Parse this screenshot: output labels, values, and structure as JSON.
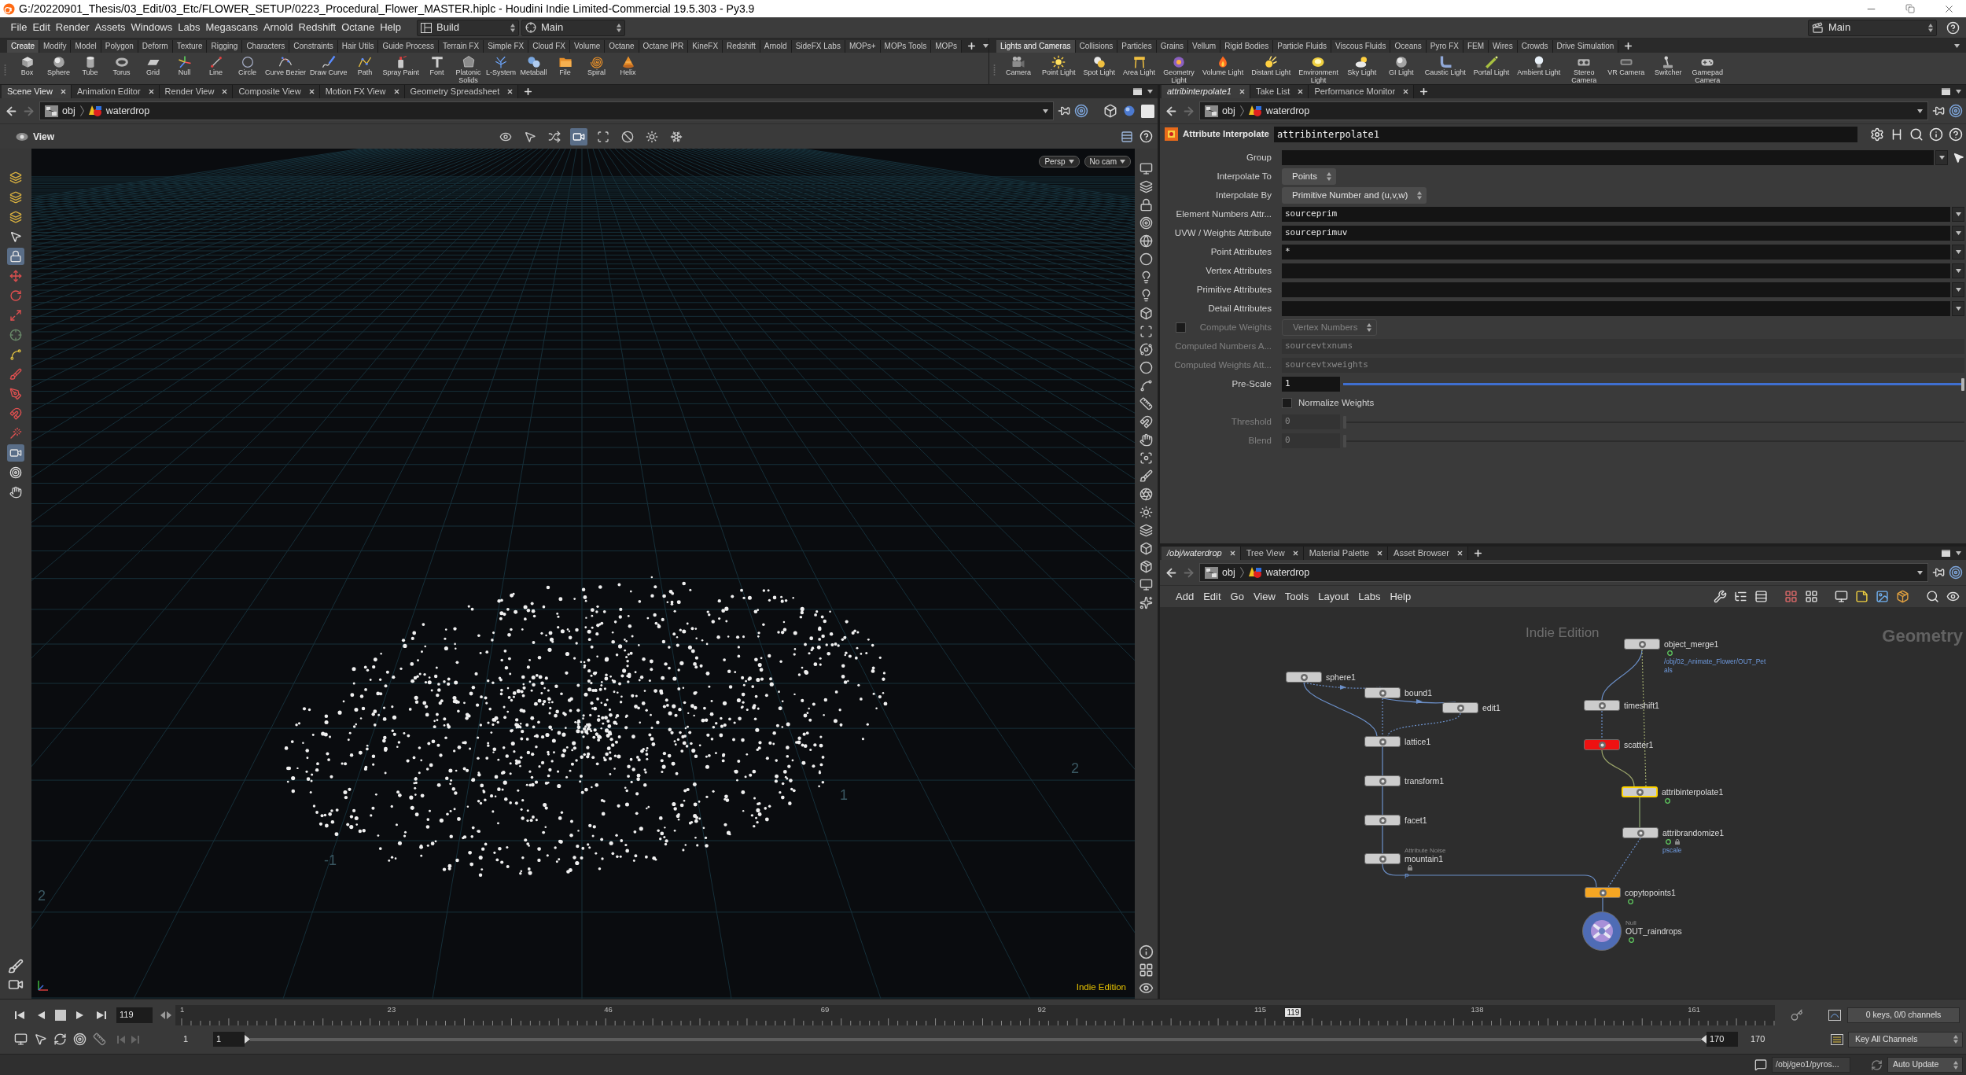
{
  "title_bar": {
    "title": "G:/20220901_Thesis/03_Edit/03_Etc/FLOWER_SETUP/0223_Procedural_Flower_MASTER.hiplc - Houdini Indie Limited-Commercial 19.5.303 - Py3.9"
  },
  "menu_bar": {
    "items": [
      "File",
      "Edit",
      "Render",
      "Assets",
      "Windows",
      "Labs",
      "Megascans",
      "Arnold",
      "Redshift",
      "Octane",
      "Help"
    ],
    "desktop": "Build",
    "context": "Main",
    "right_desktop": "Main"
  },
  "shelves": [
    {
      "tabs": [
        {
          "label": "Create",
          "selected": true
        },
        {
          "label": "Modify",
          "selected": false
        },
        {
          "label": "Model",
          "selected": false
        },
        {
          "label": "Polygon",
          "selected": false
        },
        {
          "label": "Deform",
          "selected": false
        },
        {
          "label": "Texture",
          "selected": false
        },
        {
          "label": "Rigging",
          "selected": false
        },
        {
          "label": "Characters",
          "selected": false
        },
        {
          "label": "Constraints",
          "selected": false
        },
        {
          "label": "Hair Utils",
          "selected": false
        },
        {
          "label": "Guide Process",
          "selected": false
        },
        {
          "label": "Terrain FX",
          "selected": false
        },
        {
          "label": "Simple FX",
          "selected": false
        },
        {
          "label": "Cloud FX",
          "selected": false
        },
        {
          "label": "Volume",
          "selected": false
        },
        {
          "label": "Octane",
          "selected": false
        },
        {
          "label": "Octane IPR",
          "selected": false
        },
        {
          "label": "KineFX",
          "selected": false
        },
        {
          "label": "Redshift",
          "selected": false
        },
        {
          "label": "Arnold",
          "selected": false
        },
        {
          "label": "SideFX Labs",
          "selected": false
        },
        {
          "label": "MOPs+",
          "selected": false
        },
        {
          "label": "MOPs Tools",
          "selected": false
        },
        {
          "label": "MOPs",
          "selected": false
        }
      ],
      "tools": [
        "Box",
        "Sphere",
        "Tube",
        "Torus",
        "Grid",
        "Null",
        "Line",
        "Circle",
        "Curve Bezier",
        "Draw Curve",
        "Path",
        "Spray Paint",
        "Font",
        "Platonic\nSolids",
        "L-System",
        "Metaball",
        "File",
        "Spiral",
        "Helix"
      ]
    },
    {
      "tabs": [
        {
          "label": "Lights and Cameras",
          "selected": true
        },
        {
          "label": "Collisions",
          "selected": false
        },
        {
          "label": "Particles",
          "selected": false
        },
        {
          "label": "Grains",
          "selected": false
        },
        {
          "label": "Vellum",
          "selected": false
        },
        {
          "label": "Rigid Bodies",
          "selected": false
        },
        {
          "label": "Particle Fluids",
          "selected": false
        },
        {
          "label": "Viscous Fluids",
          "selected": false
        },
        {
          "label": "Oceans",
          "selected": false
        },
        {
          "label": "Pyro FX",
          "selected": false
        },
        {
          "label": "FEM",
          "selected": false
        },
        {
          "label": "Wires",
          "selected": false
        },
        {
          "label": "Crowds",
          "selected": false
        },
        {
          "label": "Drive Simulation",
          "selected": false
        }
      ],
      "tools": [
        "Camera",
        "Point Light",
        "Spot Light",
        "Area Light",
        "Geometry\nLight",
        "Volume Light",
        "Distant Light",
        "Environment\nLight",
        "Sky Light",
        "GI Light",
        "Caustic Light",
        "Portal Light",
        "Ambient Light",
        "Stereo\nCamera",
        "VR Camera",
        "Switcher",
        "Gamepad\nCamera"
      ]
    }
  ],
  "scene_pane": {
    "tabs": [
      {
        "label": "Scene View",
        "selected": true
      },
      {
        "label": "Animation Editor",
        "selected": false
      },
      {
        "label": "Render View",
        "selected": false
      },
      {
        "label": "Composite View",
        "selected": false
      },
      {
        "label": "Motion FX View",
        "selected": false
      },
      {
        "label": "Geometry Spreadsheet",
        "selected": false
      }
    ],
    "path": [
      "obj",
      "waterdrop"
    ],
    "toolbar": {
      "title": "View",
      "tools": [
        {
          "selected": false
        },
        {
          "selected": false
        },
        {
          "selected": false
        },
        {
          "selected": true
        },
        {
          "selected": false
        },
        {
          "selected": false
        },
        {
          "selected": false
        },
        {
          "selected": false
        }
      ]
    },
    "left_tools": [
      {
        "selected": false
      },
      {
        "selected": false
      },
      {
        "selected": false
      },
      {
        "selected": false
      },
      {
        "selected": true
      },
      {
        "selected": false
      },
      {
        "selected": false
      },
      {
        "selected": false
      },
      {
        "selected": false
      },
      {
        "selected": false
      },
      {
        "selected": false
      },
      {
        "selected": false
      },
      {
        "selected": false
      },
      {
        "selected": false
      },
      {
        "selected": true
      },
      {
        "selected": false
      },
      {
        "selected": false
      }
    ],
    "viewport": {
      "view_menu": "Persp",
      "camera_menu": "No cam",
      "grid_labels": [
        "2",
        "1",
        "-1",
        "2"
      ],
      "edition_label": "Indie Edition"
    }
  },
  "parameter_pane": {
    "tabs": [
      {
        "label": "attribinterpolate1",
        "selected": true,
        "follows_selection": true
      },
      {
        "label": "Take List",
        "selected": false,
        "follows_selection": false
      },
      {
        "label": "Performance Monitor",
        "selected": false,
        "follows_selection": false
      }
    ],
    "path": [
      "obj",
      "waterdrop"
    ],
    "node_type": "Attribute Interpolate",
    "node_name": "attribinterpolate1",
    "parameters": [
      {
        "kind": "group",
        "label": "Group",
        "disabled": false
      },
      {
        "kind": "menu",
        "label": "Interpolate To",
        "value": "Points",
        "disabled": false
      },
      {
        "kind": "menu",
        "label": "Interpolate By",
        "value": "Primitive Number and (u,v,w)",
        "disabled": false
      },
      {
        "kind": "string",
        "label": "Element Numbers Attr...",
        "value": "sourceprim",
        "disabled": false
      },
      {
        "kind": "string",
        "label": "UVW / Weights Attribute",
        "value": "sourceprimuv",
        "disabled": false
      },
      {
        "kind": "string",
        "label": "Point Attributes",
        "value": "*",
        "disabled": false
      },
      {
        "kind": "string",
        "label": "Vertex Attributes",
        "disabled": false
      },
      {
        "kind": "string",
        "label": "Primitive Attributes",
        "disabled": false
      },
      {
        "kind": "string",
        "label": "Detail Attributes",
        "disabled": false
      },
      {
        "kind": "toggle_menu",
        "label": "Compute Weights",
        "value": "Vertex Numbers",
        "checked": false,
        "disabled": true
      },
      {
        "kind": "text",
        "label": "Computed Numbers A...",
        "value": "sourcevtxnums",
        "disabled": true
      },
      {
        "kind": "text",
        "label": "Computed Weights Att...",
        "value": "sourcevtxweights",
        "disabled": true
      },
      {
        "kind": "slider",
        "label": "Pre-Scale",
        "value": "1",
        "level": 1,
        "disabled": false
      },
      {
        "kind": "toggle",
        "label": "Normalize Weights",
        "checked": false,
        "disabled": false
      },
      {
        "kind": "slider",
        "label": "Threshold",
        "value": "0",
        "level": 0,
        "disabled": true
      },
      {
        "kind": "slider",
        "label": "Blend",
        "value": "0",
        "level": 0,
        "disabled": true
      }
    ]
  },
  "network_pane": {
    "tabs": [
      {
        "label": "/obj/waterdrop",
        "selected": true,
        "follows_selection": true
      },
      {
        "label": "Tree View",
        "selected": false,
        "follows_selection": false
      },
      {
        "label": "Material Palette",
        "selected": false,
        "follows_selection": false
      },
      {
        "label": "Asset Browser",
        "selected": false,
        "follows_selection": false
      }
    ],
    "path": [
      "obj",
      "waterdrop"
    ],
    "menu": [
      "Add",
      "Edit",
      "Go",
      "View",
      "Tools",
      "Layout",
      "Labs",
      "Help"
    ],
    "edition_label": "Indie Edition",
    "context_label": "Geometry",
    "nodes": [
      {
        "name": "object_merge1",
        "kind": "node",
        "color": "#cccccc",
        "selected": false,
        "status_ring": true,
        "locked": false,
        "note": "/obj/02_Animate_Flower/OUT_Pet\nals"
      },
      {
        "name": "sphere1",
        "kind": "node",
        "color": "#cccccc",
        "selected": false,
        "status_ring": false,
        "locked": false
      },
      {
        "name": "bound1",
        "kind": "node",
        "color": "#cccccc",
        "selected": false,
        "status_ring": false,
        "locked": false
      },
      {
        "name": "timeshift1",
        "kind": "node",
        "color": "#cccccc",
        "selected": false,
        "status_ring": false,
        "locked": false
      },
      {
        "name": "edit1",
        "kind": "node",
        "color": "#cccccc",
        "selected": false,
        "status_ring": false,
        "locked": false
      },
      {
        "name": "lattice1",
        "kind": "node",
        "color": "#cccccc",
        "selected": false,
        "status_ring": false,
        "locked": false
      },
      {
        "name": "scatter1",
        "kind": "node",
        "color": "#ee1111",
        "selected": false,
        "status_ring": false,
        "locked": false
      },
      {
        "name": "transform1",
        "kind": "node",
        "color": "#cccccc",
        "selected": false,
        "status_ring": false,
        "locked": false
      },
      {
        "name": "attribinterpolate1",
        "kind": "node",
        "color": "#cccccc",
        "selected": true,
        "status_ring": true,
        "locked": false
      },
      {
        "name": "facet1",
        "kind": "node",
        "color": "#cccccc",
        "selected": false,
        "status_ring": false,
        "locked": false
      },
      {
        "name": "attribrandomize1",
        "kind": "node",
        "color": "#cccccc",
        "selected": false,
        "status_ring": true,
        "locked": true,
        "note": "pscale"
      },
      {
        "name": "mountain1",
        "kind": "node",
        "color": "#cccccc",
        "selected": false,
        "status_ring": false,
        "locked": true,
        "type_label": "Attribute Noise",
        "note": "P"
      },
      {
        "name": "copytopoints1",
        "kind": "node",
        "color": "#f5a623",
        "selected": false,
        "status_ring": true,
        "locked": false
      },
      {
        "name": "OUT_raindrops",
        "kind": "null",
        "color": "#4f6cb5",
        "selected": false,
        "status_ring": true,
        "locked": false,
        "type_label": "Null"
      }
    ]
  },
  "playbar": {
    "current_frame": "119",
    "ruler_labels": [
      "1",
      "23",
      "46",
      "69",
      "92",
      "115",
      "138",
      "161"
    ],
    "playhead": {
      "label": "119",
      "level": 0.698
    },
    "keys_info": "0 keys, 0/0 channels",
    "range_start_label": "1",
    "range_start": "1",
    "range_end": "170",
    "range_end_label": "170",
    "key_menu": "Key All Channels"
  },
  "status_bar": {
    "node_path": "/obj/geo1/pyros...",
    "update_mode": "Auto Update"
  }
}
